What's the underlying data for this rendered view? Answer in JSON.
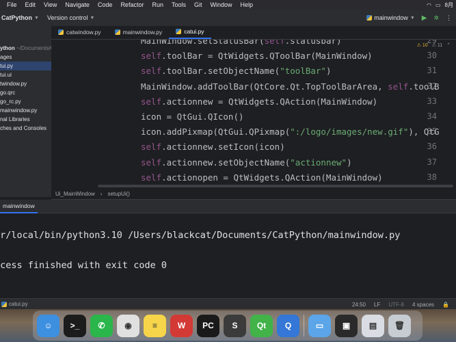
{
  "menubar": {
    "items": [
      "File",
      "Edit",
      "View",
      "Navigate",
      "Code",
      "Refactor",
      "Run",
      "Tools",
      "Git",
      "Window",
      "Help"
    ],
    "clock": "8月"
  },
  "toolbar": {
    "project": "CatPython",
    "version_control": "Version control",
    "run_config": "mainwindow"
  },
  "project_panel": {
    "root_name": "ython",
    "root_path": "~/Documents/C",
    "rows": [
      "ages",
      "tui.py",
      "tui.ui",
      "twindow.py",
      "go.qrc",
      "go_rc.py",
      "mainwindow.py",
      "nal Libraries",
      "ches and Consoles"
    ],
    "selected_index": 1
  },
  "tabs": [
    {
      "label": "catwindow.py"
    },
    {
      "label": "mainwindow.py"
    },
    {
      "label": "catui.py"
    }
  ],
  "active_tab": 2,
  "editor": {
    "inspection_warnings": "10",
    "inspection_weak": "11",
    "lines": [
      {
        "num": "29",
        "parts": [
          {
            "t": "MainWindow.setStatusBar(",
            "c": "cls"
          },
          {
            "t": "self",
            "c": "kw"
          },
          {
            "t": ".statusbar)",
            "c": "cls"
          }
        ]
      },
      {
        "num": "30",
        "parts": [
          {
            "t": "self",
            "c": "kw"
          },
          {
            "t": ".toolBar = QtWidgets.QToolBar(MainWindow)",
            "c": "cls"
          }
        ]
      },
      {
        "num": "31",
        "parts": [
          {
            "t": "self",
            "c": "kw"
          },
          {
            "t": ".toolBar.setObjectName(",
            "c": "cls"
          },
          {
            "t": "\"toolBar\"",
            "c": "str"
          },
          {
            "t": ")",
            "c": "cls"
          }
        ]
      },
      {
        "num": "32",
        "parts": [
          {
            "t": "MainWindow.addToolBar(QtCore.Qt.TopToolBarArea, ",
            "c": "cls"
          },
          {
            "t": "self",
            "c": "kw"
          },
          {
            "t": ".toolB",
            "c": "cls"
          }
        ]
      },
      {
        "num": "33",
        "parts": [
          {
            "t": "self",
            "c": "kw"
          },
          {
            "t": ".actionnew = QtWidgets.QAction(MainWindow)",
            "c": "cls"
          }
        ]
      },
      {
        "num": "34",
        "parts": [
          {
            "t": "icon = QtGui.QIcon()",
            "c": "cls"
          }
        ]
      },
      {
        "num": "35",
        "parts": [
          {
            "t": "icon.addPixmap(QtGui.QPixmap(",
            "c": "cls"
          },
          {
            "t": "\":/logo/images/new.gif\"",
            "c": "str"
          },
          {
            "t": "), QtG",
            "c": "cls"
          }
        ]
      },
      {
        "num": "36",
        "parts": [
          {
            "t": "self",
            "c": "kw"
          },
          {
            "t": ".actionnew.setIcon(icon)",
            "c": "cls"
          }
        ]
      },
      {
        "num": "37",
        "parts": [
          {
            "t": "self",
            "c": "kw"
          },
          {
            "t": ".actionnew.setObjectName(",
            "c": "cls"
          },
          {
            "t": "\"actionnew\"",
            "c": "str"
          },
          {
            "t": ")",
            "c": "cls"
          }
        ]
      },
      {
        "num": "38",
        "parts": [
          {
            "t": "self",
            "c": "kw"
          },
          {
            "t": ".actionopen = QtWidgets.QAction(MainWindow)",
            "c": "cls"
          }
        ]
      }
    ]
  },
  "breadcrumbs": [
    "Ui_MainWindow",
    "setupUi()"
  ],
  "run_panel": {
    "tab_label": "mainwindow",
    "command": "sr/local/bin/python3.10 /Users/blackcat/Documents/CatPython/mainwindow.py",
    "result": "ocess finished with exit code 0"
  },
  "statusbar": {
    "file": "catui.py",
    "position": "24:50",
    "line_sep": "LF",
    "encoding": "UTF-8",
    "indent": "4 spaces"
  },
  "dock": {
    "apps": [
      {
        "name": "finder-icon",
        "color": "#3d8fe0",
        "glyph": "☺"
      },
      {
        "name": "terminal-icon",
        "color": "#1c1c1c",
        "glyph": ">_"
      },
      {
        "name": "wechat-icon",
        "color": "#2ab64a",
        "glyph": "✆"
      },
      {
        "name": "chrome-icon",
        "color": "#e0e0e0",
        "glyph": "◉"
      },
      {
        "name": "notes-icon",
        "color": "#f6d54a",
        "glyph": "≡"
      },
      {
        "name": "wps-icon",
        "color": "#d33a36",
        "glyph": "W"
      },
      {
        "name": "pycharm-icon",
        "color": "#1a1a1a",
        "glyph": "PC"
      },
      {
        "name": "sublime-icon",
        "color": "#3b3b3b",
        "glyph": "S"
      },
      {
        "name": "qt-icon",
        "color": "#41b349",
        "glyph": "Qt"
      },
      {
        "name": "quicktime-icon",
        "color": "#3477d6",
        "glyph": "Q"
      }
    ],
    "right_apps": [
      {
        "name": "folder-icon",
        "color": "#5ba5e8",
        "glyph": "▭"
      },
      {
        "name": "screen-icon",
        "color": "#2a2a2a",
        "glyph": "▣"
      },
      {
        "name": "window-icon",
        "color": "#d9dde3",
        "glyph": "▤"
      },
      {
        "name": "trash-icon",
        "color": "#c7ccd3",
        "glyph": "🗑"
      }
    ]
  }
}
